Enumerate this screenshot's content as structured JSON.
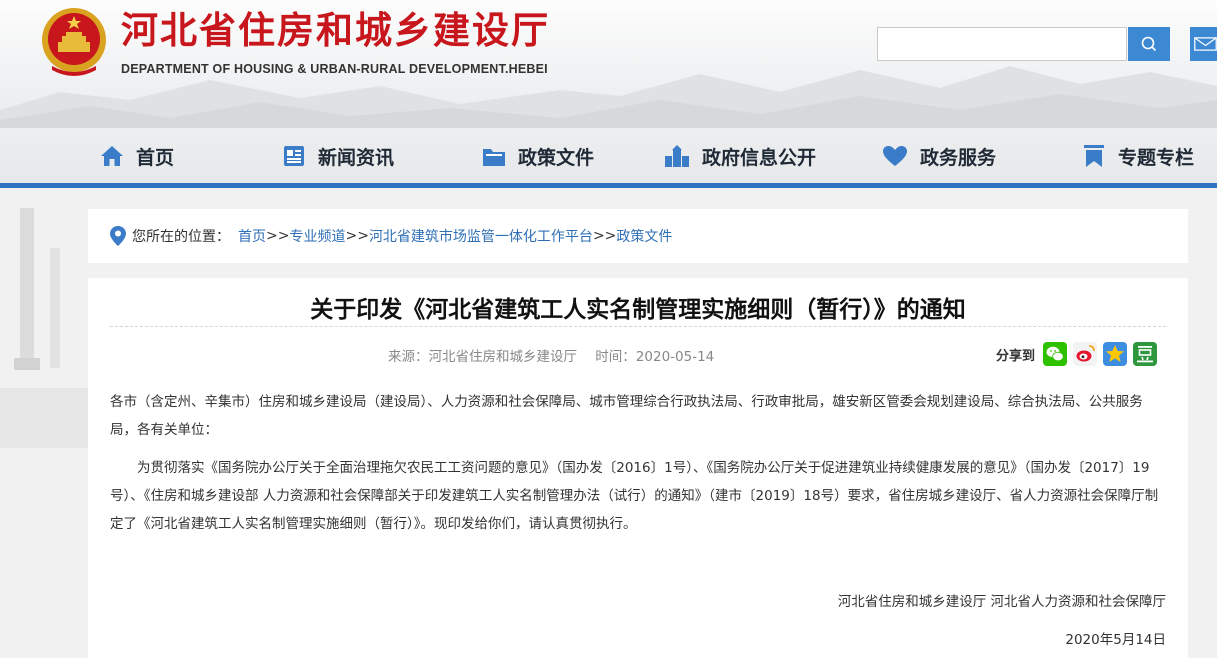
{
  "site": {
    "title": "河北省住房和城乡建设厅",
    "subtitle": "DEPARTMENT OF HOUSING & URBAN-RURAL DEVELOPMENT.HEBEI"
  },
  "search": {
    "value": "",
    "placeholder": ""
  },
  "nav": {
    "items": [
      {
        "label": "首页",
        "icon": "home-icon"
      },
      {
        "label": "新闻资讯",
        "icon": "news-icon"
      },
      {
        "label": "政策文件",
        "icon": "folder-icon"
      },
      {
        "label": "政府信息公开",
        "icon": "building-icon"
      },
      {
        "label": "政务服务",
        "icon": "heart-icon"
      },
      {
        "label": "专题专栏",
        "icon": "bookmark-icon"
      }
    ]
  },
  "breadcrumb": {
    "label": "您所在的位置：",
    "items": [
      "首页",
      "专业频道",
      "河北省建筑市场监管一体化工作平台",
      "政策文件"
    ],
    "separator": ">>"
  },
  "article": {
    "title": "关于印发《河北省建筑工人实名制管理实施细则（暂行）》的通知",
    "source": "来源：河北省住房和城乡建设厅",
    "time": "时间：2020-05-14",
    "share_label": "分享到",
    "share_icons": [
      "wechat-icon",
      "weibo-icon",
      "qzone-icon",
      "douban-icon"
    ],
    "paragraph1": "各市（含定州、辛集市）住房和城乡建设局（建设局）、人力资源和社会保障局、城市管理综合行政执法局、行政审批局，雄安新区管委会规划建设局、综合执法局、公共服务局，各有关单位：",
    "paragraph2": "为贯彻落实《国务院办公厅关于全面治理拖欠农民工工资问题的意见》（国办发〔2016〕1号）、《国务院办公厅关于促进建筑业持续健康发展的意见》（国办发〔2017〕19号）、《住房和城乡建设部 人力资源和社会保障部关于印发建筑工人实名制管理办法（试行）的通知》（建市〔2019〕18号）要求，省住房城乡建设厅、省人力资源社会保障厅制定了《河北省建筑工人实名制管理实施细则（暂行）》。现印发给你们，请认真贯彻执行。",
    "signature": "河北省住房和城乡建设厅  河北省人力资源和社会保障厅",
    "date": "2020年5月14日"
  },
  "colors": {
    "brand_red": "#c8161d",
    "nav_blue": "#2f74c0",
    "link_blue": "#2f6fb6"
  }
}
